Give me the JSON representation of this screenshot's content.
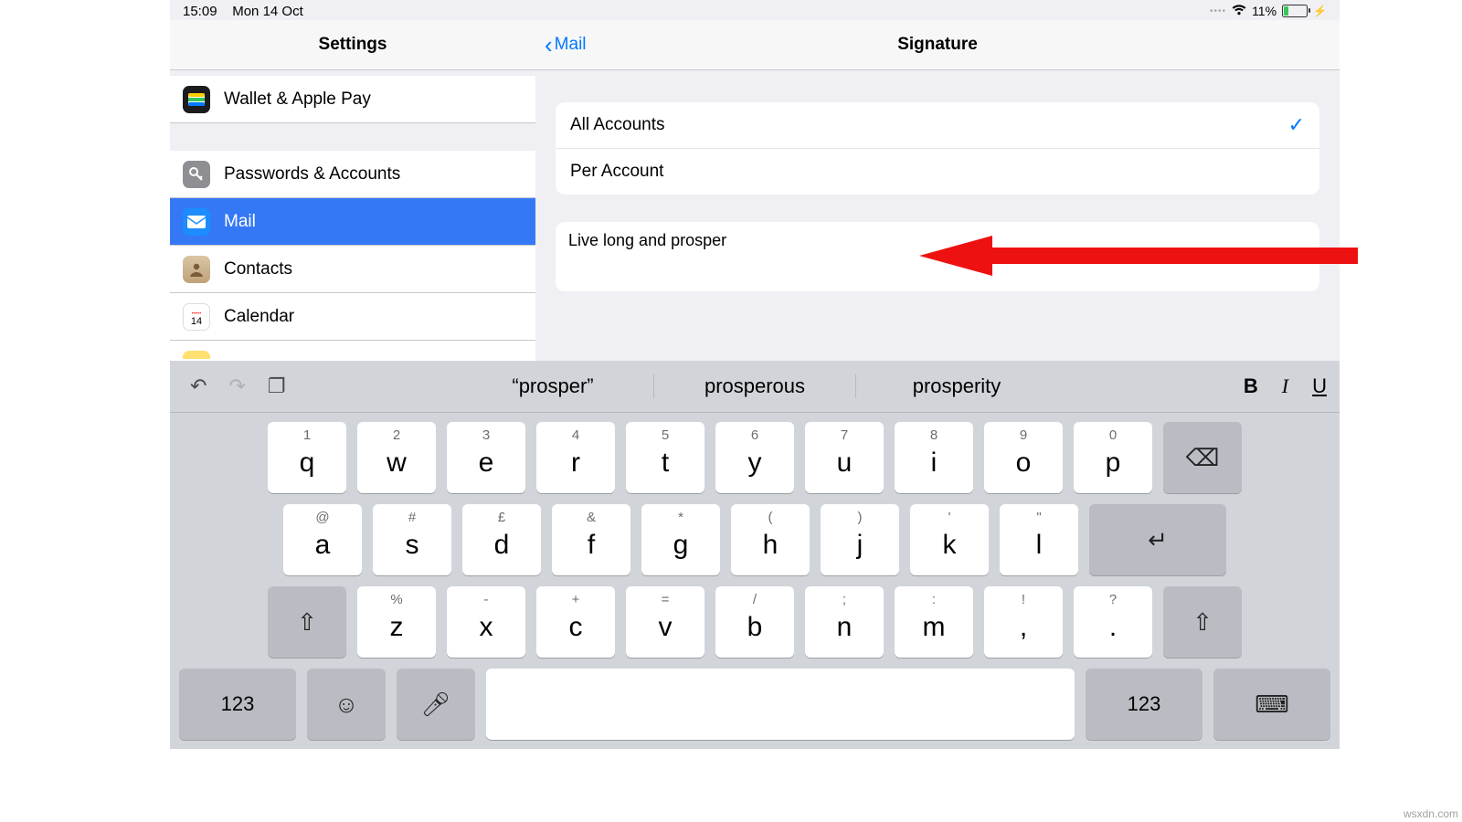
{
  "status": {
    "time": "15:09",
    "date": "Mon 14 Oct",
    "battery_pct": "11%"
  },
  "master": {
    "title": "Settings",
    "items": [
      {
        "label": "Wallet & Apple Pay"
      },
      {
        "label": "Passwords & Accounts"
      },
      {
        "label": "Mail"
      },
      {
        "label": "Contacts"
      },
      {
        "label": "Calendar"
      }
    ]
  },
  "detail": {
    "back": "Mail",
    "title": "Signature",
    "options": {
      "all": "All Accounts",
      "per": "Per Account"
    },
    "signature_text": "Live long and prosper"
  },
  "keyboard": {
    "suggestions": [
      "“prosper”",
      "prosperous",
      "prosperity"
    ],
    "format": {
      "b": "B",
      "i": "I",
      "u": "U"
    },
    "row1": [
      {
        "a": "1",
        "m": "q"
      },
      {
        "a": "2",
        "m": "w"
      },
      {
        "a": "3",
        "m": "e"
      },
      {
        "a": "4",
        "m": "r"
      },
      {
        "a": "5",
        "m": "t"
      },
      {
        "a": "6",
        "m": "y"
      },
      {
        "a": "7",
        "m": "u"
      },
      {
        "a": "8",
        "m": "i"
      },
      {
        "a": "9",
        "m": "o"
      },
      {
        "a": "0",
        "m": "p"
      }
    ],
    "row2": [
      {
        "a": "@",
        "m": "a"
      },
      {
        "a": "#",
        "m": "s"
      },
      {
        "a": "£",
        "m": "d"
      },
      {
        "a": "&",
        "m": "f"
      },
      {
        "a": "*",
        "m": "g"
      },
      {
        "a": "(",
        "m": "h"
      },
      {
        "a": ")",
        "m": "j"
      },
      {
        "a": "'",
        "m": "k"
      },
      {
        "a": "\"",
        "m": "l"
      }
    ],
    "row3": [
      {
        "a": "%",
        "m": "z"
      },
      {
        "a": "-",
        "m": "x"
      },
      {
        "a": "+",
        "m": "c"
      },
      {
        "a": "=",
        "m": "v"
      },
      {
        "a": "/",
        "m": "b"
      },
      {
        "a": ";",
        "m": "n"
      },
      {
        "a": ":",
        "m": "m"
      },
      {
        "a": "!",
        "m": ","
      },
      {
        "a": "?",
        "m": "."
      }
    ],
    "numkey": "123"
  },
  "watermark": "wsxdn.com"
}
